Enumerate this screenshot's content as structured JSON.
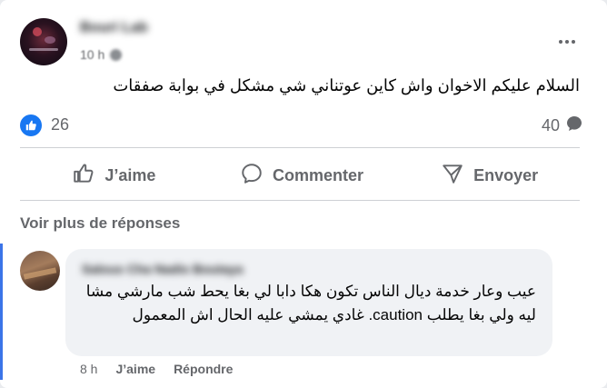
{
  "post": {
    "author": "Bouri Lab",
    "time": "10 h",
    "text": "السلام عليكم الاخوان واش كاين عوتناني شي مشكل في بوابة صفقات",
    "reactions": {
      "likes": "26",
      "comments": "40"
    }
  },
  "actions": {
    "like": "J’aime",
    "comment": "Commenter",
    "send": "Envoyer"
  },
  "comments": {
    "see_more": "Voir plus de réponses",
    "items": [
      {
        "author": "Salous Cha Nadis Boutaya",
        "text": "عيب وعار خدمة ديال الناس تكون هكا دابا لي بغا يحط شب مارشي مشا ليه ولي بغا يطلب caution. غادي يمشي عليه الحال اش المعمول",
        "time": "8 h",
        "like_label": "J’aime",
        "reply_label": "Répondre"
      }
    ]
  },
  "icons": {
    "like_badge": "thumbs-up-icon",
    "comment_count": "speech-bubble-icon",
    "more": "three-dots-icon",
    "like": "thumbs-up-outline-icon",
    "comment": "comment-outline-icon",
    "send": "send-outline-icon"
  },
  "colors": {
    "accent": "#1877f2",
    "secondary_text": "#65676b",
    "thread_line": "#3b74e8",
    "bubble": "#f0f2f5"
  }
}
